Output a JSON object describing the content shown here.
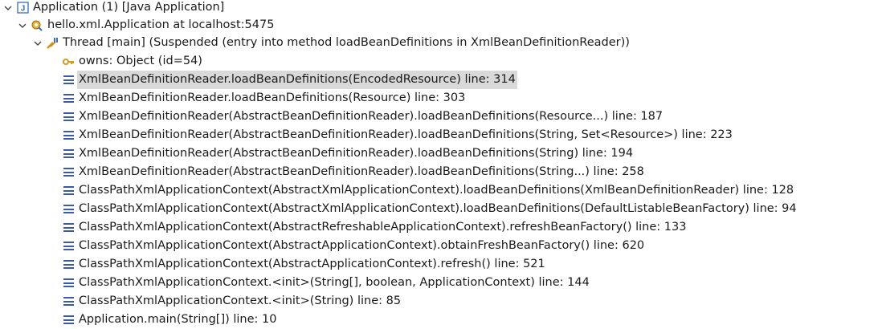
{
  "debug_tree": {
    "app": {
      "label": "Application (1) [Java Application]",
      "target": {
        "label": "hello.xml.Application at localhost:5475",
        "thread": {
          "label": "Thread [main] (Suspended (entry into method loadBeanDefinitions in XmlBeanDefinitionReader))",
          "owns": "owns: Object  (id=54)",
          "frames": [
            "XmlBeanDefinitionReader.loadBeanDefinitions(EncodedResource) line: 314",
            "XmlBeanDefinitionReader.loadBeanDefinitions(Resource) line: 303",
            "XmlBeanDefinitionReader(AbstractBeanDefinitionReader).loadBeanDefinitions(Resource...) line: 187",
            "XmlBeanDefinitionReader(AbstractBeanDefinitionReader).loadBeanDefinitions(String, Set<Resource>) line: 223",
            "XmlBeanDefinitionReader(AbstractBeanDefinitionReader).loadBeanDefinitions(String) line: 194",
            "XmlBeanDefinitionReader(AbstractBeanDefinitionReader).loadBeanDefinitions(String...) line: 258",
            "ClassPathXmlApplicationContext(AbstractXmlApplicationContext).loadBeanDefinitions(XmlBeanDefinitionReader) line: 128",
            "ClassPathXmlApplicationContext(AbstractXmlApplicationContext).loadBeanDefinitions(DefaultListableBeanFactory) line: 94",
            "ClassPathXmlApplicationContext(AbstractRefreshableApplicationContext).refreshBeanFactory() line: 133",
            "ClassPathXmlApplicationContext(AbstractApplicationContext).obtainFreshBeanFactory() line: 620",
            "ClassPathXmlApplicationContext(AbstractApplicationContext).refresh() line: 521",
            "ClassPathXmlApplicationContext.<init>(String[], boolean, ApplicationContext) line: 144",
            "ClassPathXmlApplicationContext.<init>(String) line: 85",
            "Application.main(String[]) line: 10"
          ]
        }
      }
    }
  },
  "colors": {
    "selection": "#d9d9d9",
    "frame_icon": "#3b5aa8",
    "thread_icon": "#c8941e",
    "java_app_icon": "#3a6bb8"
  }
}
